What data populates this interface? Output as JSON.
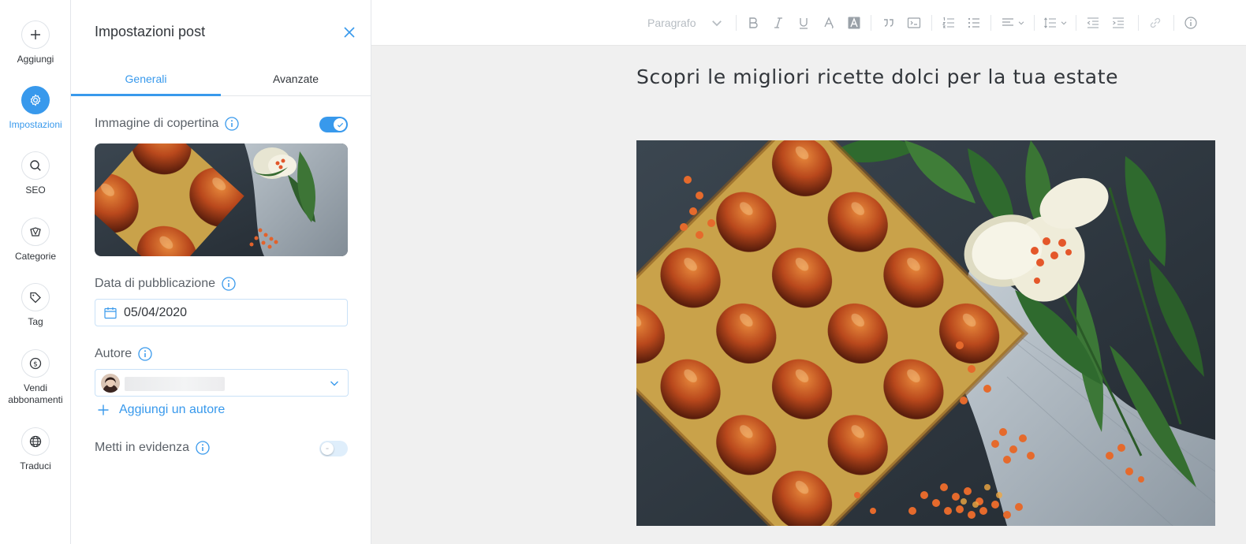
{
  "rail": {
    "items": [
      {
        "label": "Aggiungi",
        "icon": "plus-icon"
      },
      {
        "label": "Impostazioni",
        "icon": "gear-icon",
        "active": true
      },
      {
        "label": "SEO",
        "icon": "search-icon"
      },
      {
        "label": "Categorie",
        "icon": "categories-icon"
      },
      {
        "label": "Tag",
        "icon": "tag-icon"
      },
      {
        "label": "Vendi abbonamenti",
        "icon": "dollar-icon"
      },
      {
        "label": "Traduci",
        "icon": "globe-icon"
      }
    ]
  },
  "panel": {
    "title": "Impostazioni post",
    "tabs": [
      {
        "label": "Generali",
        "active": true
      },
      {
        "label": "Avanzate",
        "active": false
      }
    ],
    "cover": {
      "label": "Immagine di copertina",
      "enabled": true
    },
    "publish_date": {
      "label": "Data di pubblicazione",
      "value": "05/04/2020"
    },
    "author": {
      "label": "Autore",
      "add_label": "Aggiungi un autore"
    },
    "featured": {
      "label": "Metti in evidenza",
      "enabled": false
    }
  },
  "toolbar": {
    "paragraph_label": "Paragrafo",
    "buttons": [
      "bold-icon",
      "italic-icon",
      "underline-icon",
      "text-color-icon",
      "highlight-icon",
      "quote-icon",
      "code-block-icon",
      "ordered-list-icon",
      "bullet-list-icon",
      "align-icon",
      "line-spacing-icon",
      "decrease-indent-icon",
      "increase-indent-icon",
      "link-icon",
      "info-icon"
    ]
  },
  "editor": {
    "post_title": "Scopri le migliori ricette dolci per la tua estate"
  },
  "colors": {
    "accent": "#3899ec",
    "text": "#32363b",
    "editor_bg": "#f0f0f0",
    "border": "#e3e6ea"
  }
}
